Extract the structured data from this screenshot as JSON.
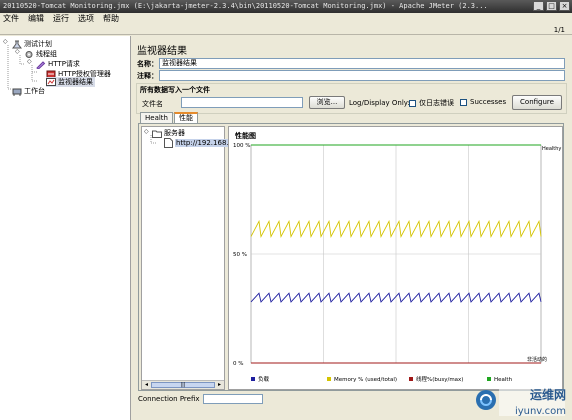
{
  "window": {
    "title": "20110520-Tomcat Monitoring.jmx (E:\\jakarta-jmeter-2.3.4\\bin\\20110520-Tomcat Monitoring.jmx) - Apache JMeter (2.3...",
    "minimize_label": "_",
    "maximize_label": "□",
    "close_label": "×"
  },
  "menu": {
    "items": [
      {
        "label": "文件"
      },
      {
        "label": "编辑"
      },
      {
        "label": "运行"
      },
      {
        "label": "选项"
      },
      {
        "label": "帮助"
      }
    ]
  },
  "toolbar": {
    "page_indicator": "1/1"
  },
  "tree": {
    "nodes": [
      {
        "label": "测试计划",
        "icon": "flask-icon"
      },
      {
        "label": "线程组",
        "icon": "gear-icon"
      },
      {
        "label": "HTTP请求",
        "icon": "pen-icon"
      },
      {
        "label": "HTTP授权管理器",
        "icon": "settings-icon"
      },
      {
        "label": "监视器结果",
        "icon": "monitor-icon",
        "selected": true
      },
      {
        "label": "工作台",
        "icon": "workbench-icon"
      }
    ]
  },
  "panel": {
    "title": "监视器结果",
    "name_label": "名称：",
    "name_value": "监视器结果",
    "comment_label": "注释：",
    "comment_value": "",
    "write_group_title": "所有数据写入一个文件",
    "filename_label": "文件名",
    "filename_value": "",
    "browse_label": "浏览...",
    "log_display_label": "Log/Display Only:",
    "errors_only_label": "仅日志错误",
    "successes_label": "Successes",
    "configure_label": "Configure"
  },
  "tabs": [
    {
      "label": "Health",
      "active": false
    },
    {
      "label": "性能",
      "active": true
    }
  ],
  "servers": {
    "root_label": "服务器",
    "items": [
      {
        "label": "http://192.168.4."
      }
    ],
    "scroll_thumb_label": "|||"
  },
  "chart_data": {
    "type": "line",
    "title": "性能图",
    "ylim": [
      0,
      100
    ],
    "ytick_labels": [
      "100 %",
      "50 %",
      "0 %"
    ],
    "right_labels": {
      "top": "Healthy",
      "bottom": "非活动的"
    },
    "grid": true,
    "legend_position": "bottom",
    "series": [
      {
        "name": "负载",
        "color": "#1f1f9f",
        "pattern": "sawtooth",
        "range": [
          28,
          32
        ],
        "cycles": 29
      },
      {
        "name": "Memory % (used/total)",
        "color": "#d4c400",
        "pattern": "sawtooth",
        "range": [
          58,
          65
        ],
        "cycles": 29
      },
      {
        "name": "线程%(busy/max)",
        "color": "#a01818",
        "pattern": "flat",
        "value": 0
      },
      {
        "name": "Health",
        "color": "#1fa61f",
        "pattern": "flat",
        "value": 100
      }
    ]
  },
  "footer": {
    "connection_prefix_label": "Connection Prefix",
    "connection_prefix_value": ""
  },
  "watermark": {
    "line1": "运维网",
    "line2": "iyunv.com"
  }
}
